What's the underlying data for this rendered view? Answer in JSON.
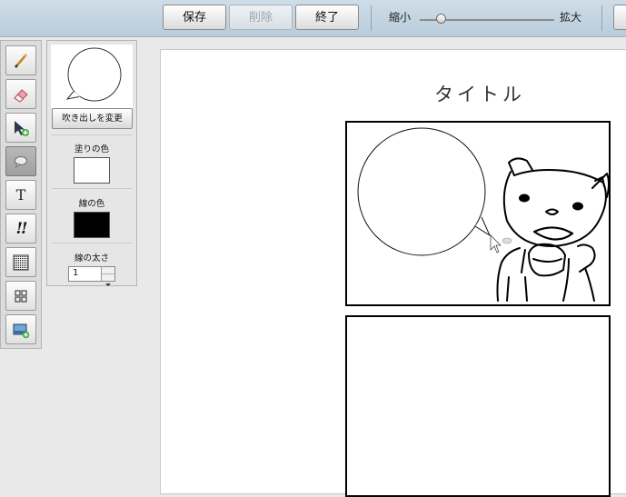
{
  "toolbar": {
    "save_label": "保存",
    "delete_label": "削除",
    "end_label": "終了",
    "zoom_out_label": "縮小",
    "zoom_in_label": "拡大",
    "zoom_level": 0.16
  },
  "tools": [
    {
      "icon": "pencil-icon"
    },
    {
      "icon": "eraser-icon"
    },
    {
      "icon": "select-add-cursor-icon"
    },
    {
      "icon": "speech-bubble-icon",
      "active": true
    },
    {
      "icon": "text-tool-icon",
      "glyph": "T"
    },
    {
      "icon": "exclamation-effect-icon",
      "glyph": "!!"
    },
    {
      "icon": "screentone-icon"
    },
    {
      "icon": "panel-grid-icon"
    },
    {
      "icon": "insert-image-icon"
    }
  ],
  "props": {
    "change_bubble_label": "吹き出しを変更",
    "fill_color_label": "塗りの色",
    "fill_color": "#FFFFFF",
    "line_color_label": "線の色",
    "line_color": "#000000",
    "line_width_label": "線の太さ",
    "line_width": "1"
  },
  "canvas": {
    "title": "タイトル"
  }
}
